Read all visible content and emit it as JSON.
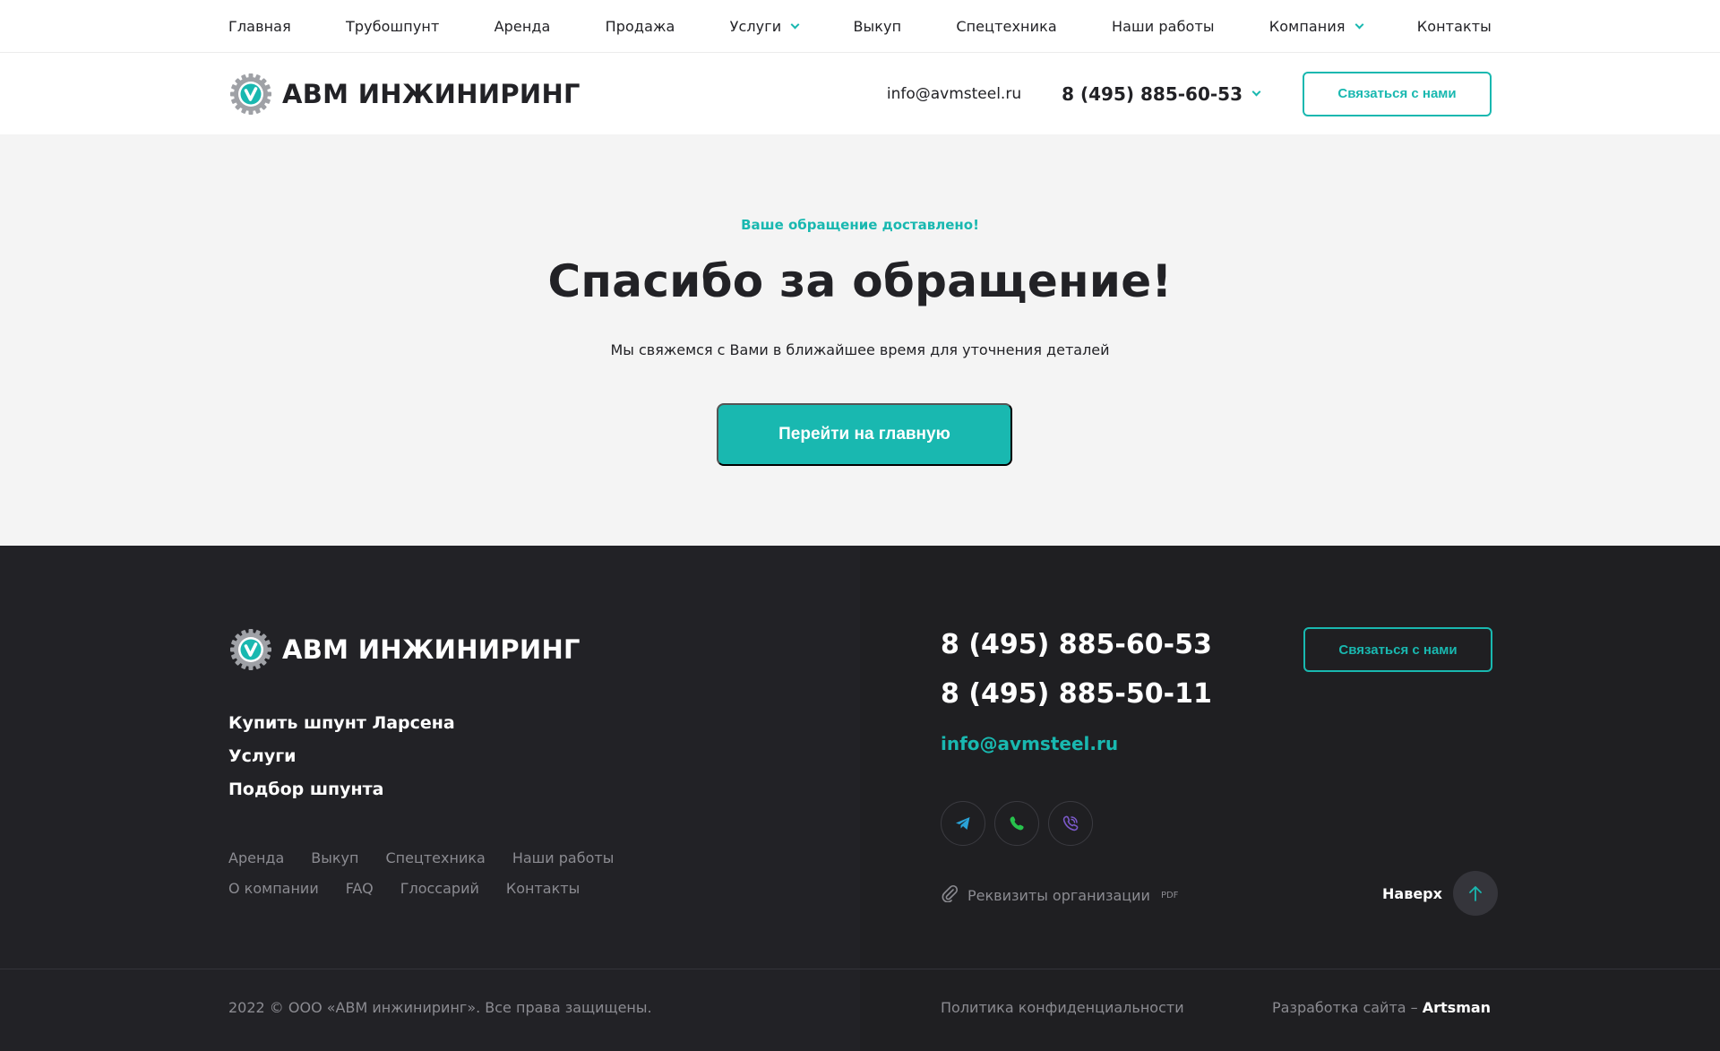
{
  "nav": {
    "items": [
      {
        "label": "Главная",
        "has_dropdown": false
      },
      {
        "label": "Трубошпунт",
        "has_dropdown": false
      },
      {
        "label": "Аренда",
        "has_dropdown": false
      },
      {
        "label": "Продажа",
        "has_dropdown": false
      },
      {
        "label": "Услуги",
        "has_dropdown": true
      },
      {
        "label": "Выкуп",
        "has_dropdown": false
      },
      {
        "label": "Спецтехника",
        "has_dropdown": false
      },
      {
        "label": "Наши работы",
        "has_dropdown": false
      },
      {
        "label": "Компания",
        "has_dropdown": true
      },
      {
        "label": "Контакты",
        "has_dropdown": false
      }
    ]
  },
  "header": {
    "logo_text": "АВМ ИНЖИНИРИНГ",
    "email": "info@avmsteel.ru",
    "phone": "8 (495) 885-60-53",
    "cta_label": "Связаться с нами"
  },
  "hero": {
    "kicker": "Ваше обращение доставлено!",
    "title": "Спасибо за обращение!",
    "subtitle": "Мы свяжемся с Вами в ближайшее время для уточнения деталей",
    "button_label": "Перейти на главную"
  },
  "footer": {
    "logo_text": "АВМ ИНЖИНИРИНГ",
    "main_links": [
      "Купить шпунт Ларсена",
      "Услуги",
      "Подбор шпунта"
    ],
    "secondary_links_row1": [
      "Аренда",
      "Выкуп",
      "Спецтехника",
      "Наши работы"
    ],
    "secondary_links_row2": [
      "О компании",
      "FAQ",
      "Глоссарий",
      "Контакты"
    ],
    "phone1": "8 (495) 885-60-53",
    "phone2": "8 (495) 885-50-11",
    "email": "info@avmsteel.ru",
    "cta_label": "Связаться с нами",
    "socials": [
      "telegram-icon",
      "phone-icon",
      "viber-icon"
    ],
    "requisites_label": "Реквизиты организации",
    "requisites_badge": "PDF",
    "to_top_label": "Наверх",
    "copyright": "2022 © ООО «АВМ инжиниринг». Все права защищены.",
    "privacy": "Политика конфиденциальности",
    "dev_prefix": "Разработка сайта – ",
    "dev_name": "Artsman"
  },
  "colors": {
    "accent": "#19b8b0",
    "footer_bg": "#222226",
    "hero_bg": "#f4f4f4",
    "telegram": "#2aa3d8",
    "whatsapp": "#27c24c",
    "viber": "#7b59c9"
  }
}
